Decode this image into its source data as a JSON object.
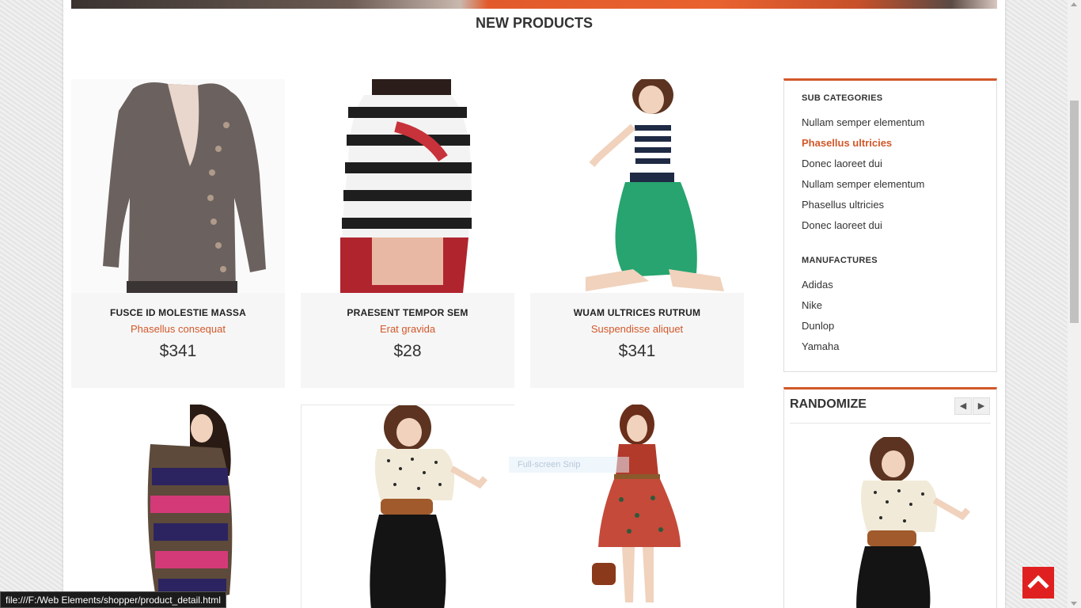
{
  "section_title": "NEW PRODUCTS",
  "products": [
    {
      "name": "FUSCE ID MOLESTIE MASSA",
      "subtitle": "Phasellus consequat",
      "price": "$341"
    },
    {
      "name": "PRAESENT TEMPOR SEM",
      "subtitle": "Erat gravida",
      "price": "$28"
    },
    {
      "name": "WUAM ULTRICES RUTRUM",
      "subtitle": "Suspendisse aliquet",
      "price": "$341"
    }
  ],
  "sidebar": {
    "sub_categories_heading": "SUB CATEGORIES",
    "sub_categories": [
      {
        "label": "Nullam semper elementum",
        "active": false
      },
      {
        "label": "Phasellus ultricies",
        "active": true
      },
      {
        "label": "Donec laoreet dui",
        "active": false
      },
      {
        "label": "Nullam semper elementum",
        "active": false
      },
      {
        "label": "Phasellus ultricies",
        "active": false
      },
      {
        "label": "Donec laoreet dui",
        "active": false
      }
    ],
    "manufactures_heading": "MANUFACTURES",
    "manufactures": [
      "Adidas",
      "Nike",
      "Dunlop",
      "Yamaha"
    ]
  },
  "randomize": {
    "title": "RANDOMIZE",
    "prev_icon": "chevron-left-icon",
    "next_icon": "chevron-right-icon"
  },
  "overlay": {
    "snip_hint": "Full-screen Snip",
    "status_url": "file:///F:/Web Elements/shopper/product_detail.html"
  },
  "colors": {
    "accent": "#d2582a",
    "back_to_top": "#e02020"
  },
  "icons": {
    "back_to_top": "arrow-up-icon"
  }
}
